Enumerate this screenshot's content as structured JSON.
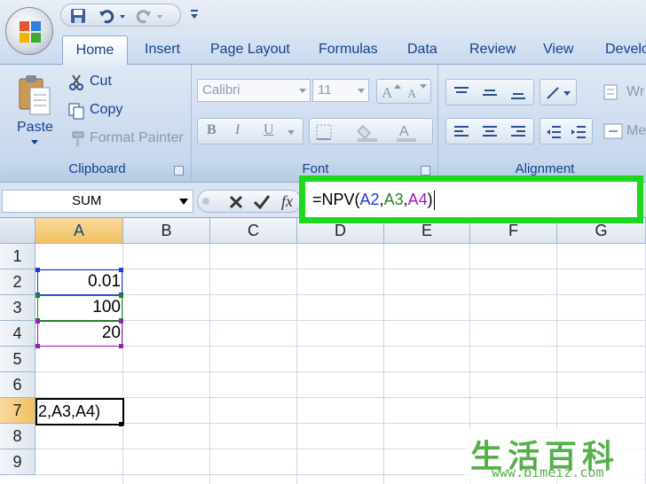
{
  "tabs": [
    "Home",
    "Insert",
    "Page Layout",
    "Formulas",
    "Data",
    "Review",
    "View",
    "Develo"
  ],
  "active_tab": "Home",
  "clipboard": {
    "paste_label": "Paste",
    "cut_label": "Cut",
    "copy_label": "Copy",
    "format_painter_label": "Format Painter",
    "group_label": "Clipboard"
  },
  "font": {
    "font_name": "Calibri",
    "font_size": "11",
    "group_label": "Font",
    "bold_glyph": "B",
    "italic_glyph": "I",
    "underline_glyph": "U"
  },
  "alignment": {
    "group_label": "Alignment",
    "wrap_text_partial": "Wr",
    "merge_partial": "Me"
  },
  "formula_bar": {
    "name_box": "SUM",
    "fx_glyph": "fx",
    "formula_parts": [
      {
        "text": "=NPV(",
        "color": "#000000"
      },
      {
        "text": "A2",
        "color": "#1f3bd6"
      },
      {
        "text": ",",
        "color": "#000000"
      },
      {
        "text": "A3",
        "color": "#1a8a1a"
      },
      {
        "text": ",",
        "color": "#000000"
      },
      {
        "text": "A4",
        "color": "#9b1fb5"
      },
      {
        "text": ")",
        "color": "#000000"
      }
    ],
    "highlight_color": "#1ed81e"
  },
  "grid": {
    "columns": [
      "A",
      "B",
      "C",
      "D",
      "E",
      "F",
      "G"
    ],
    "selected_column": "A",
    "rows": [
      "1",
      "2",
      "3",
      "4",
      "5",
      "6",
      "7",
      "8",
      "9"
    ],
    "selected_row": "7",
    "cells": {
      "A2": "0.01",
      "A3": "100",
      "A4": "20"
    },
    "active_cell_text": "2,A3,A4)",
    "ref_colors": {
      "A2": "#1f3bd6",
      "A3": "#1a8a1a",
      "A4": "#9b1fb5"
    }
  },
  "watermark": {
    "logo": "生活百科",
    "url": "www.bimeiz.com"
  }
}
